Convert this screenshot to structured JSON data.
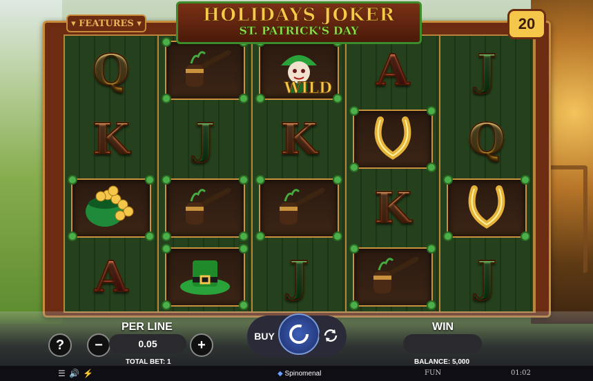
{
  "game": {
    "title_line1": "HOLIDAYS JOKER",
    "title_line2": "ST. PATRICK'S DAY",
    "features_button": "▾ FEATURES ▾",
    "lines_count": "20"
  },
  "reels": [
    [
      {
        "type": "letter",
        "text": "Q",
        "color": "gold"
      },
      {
        "type": "letter",
        "text": "K",
        "color": "orange"
      },
      {
        "type": "symbol",
        "icon": "pot-of-gold-icon",
        "glyph": "🪙"
      },
      {
        "type": "letter",
        "text": "A",
        "color": "red"
      }
    ],
    [
      {
        "type": "symbol",
        "icon": "pipe-icon",
        "glyph": "🚬"
      },
      {
        "type": "letter",
        "text": "J",
        "color": "green"
      },
      {
        "type": "symbol",
        "icon": "pipe-icon",
        "glyph": "🚬"
      },
      {
        "type": "symbol",
        "icon": "leprechaun-hat-icon",
        "glyph": "🎩"
      }
    ],
    [
      {
        "type": "wild",
        "icon": "joker-wild-icon",
        "glyph": "🃏",
        "text": "WILD"
      },
      {
        "type": "letter",
        "text": "K",
        "color": "orange"
      },
      {
        "type": "symbol",
        "icon": "pipe-icon",
        "glyph": "🚬"
      },
      {
        "type": "letter",
        "text": "J",
        "color": "green"
      }
    ],
    [
      {
        "type": "letter",
        "text": "A",
        "color": "red"
      },
      {
        "type": "symbol",
        "icon": "horseshoe-icon",
        "glyph": "U"
      },
      {
        "type": "letter",
        "text": "K",
        "color": "orange"
      },
      {
        "type": "symbol",
        "icon": "pipe-icon",
        "glyph": "🚬"
      }
    ],
    [
      {
        "type": "letter",
        "text": "J",
        "color": "green"
      },
      {
        "type": "letter",
        "text": "Q",
        "color": "gold"
      },
      {
        "type": "symbol",
        "icon": "horseshoe-icon",
        "glyph": "U"
      },
      {
        "type": "letter",
        "text": "J",
        "color": "green"
      }
    ]
  ],
  "controls": {
    "info_label": "?",
    "per_line_label": "PER LINE",
    "minus_label": "−",
    "plus_label": "+",
    "bet_value": "0.05",
    "total_bet": "TOTAL BET: 1",
    "buy_label": "BUY",
    "win_label": "WIN",
    "win_value": "",
    "balance": "BALANCE: 5,000",
    "fun_label": "FUN",
    "clock": "01:02",
    "provider": "Spinomenal"
  },
  "colors": {
    "frame": "#6b2c12",
    "gold_trim": "#c88c3a",
    "spin_blue": "#3c5fb8"
  }
}
